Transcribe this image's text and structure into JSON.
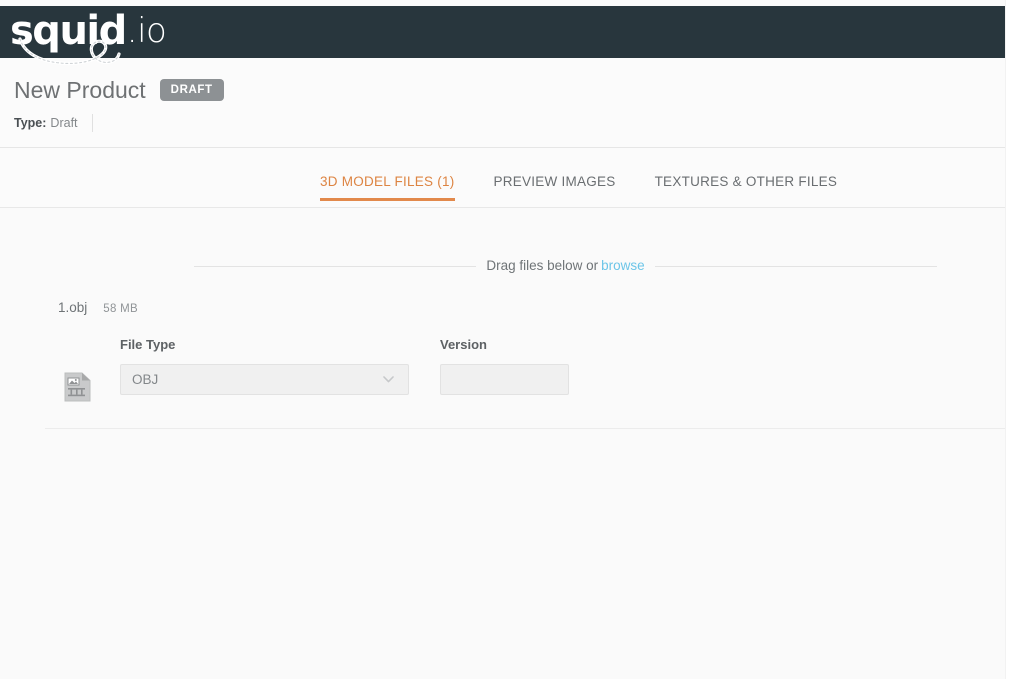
{
  "brand": {
    "logo_word": "squid",
    "logo_suffix": ".io",
    "logo_name": "squid.io",
    "bar_color": "#28363d"
  },
  "product_header": {
    "title": "New Product",
    "status_badge": "DRAFT",
    "badge_color": "#8d9194",
    "meta_label": "Type:",
    "meta_value": "Draft"
  },
  "tabs": [
    {
      "label": "3D MODEL FILES (1)",
      "active": true
    },
    {
      "label": "PREVIEW IMAGES",
      "active": false
    },
    {
      "label": "TEXTURES & OTHER FILES",
      "active": false
    }
  ],
  "tab_accent_color": "#e2894b",
  "upload": {
    "drag_text": "Drag files below or",
    "browse_label": "browse",
    "browse_color": "#6cc5e8"
  },
  "file": {
    "name": "1.obj",
    "size": "58 MB",
    "thumbnail_icon": "broken-image-icon",
    "file_type": {
      "label": "File Type",
      "value": "OBJ",
      "options": [
        "OBJ"
      ]
    },
    "version": {
      "label": "Version",
      "value": "",
      "placeholder": ""
    }
  }
}
